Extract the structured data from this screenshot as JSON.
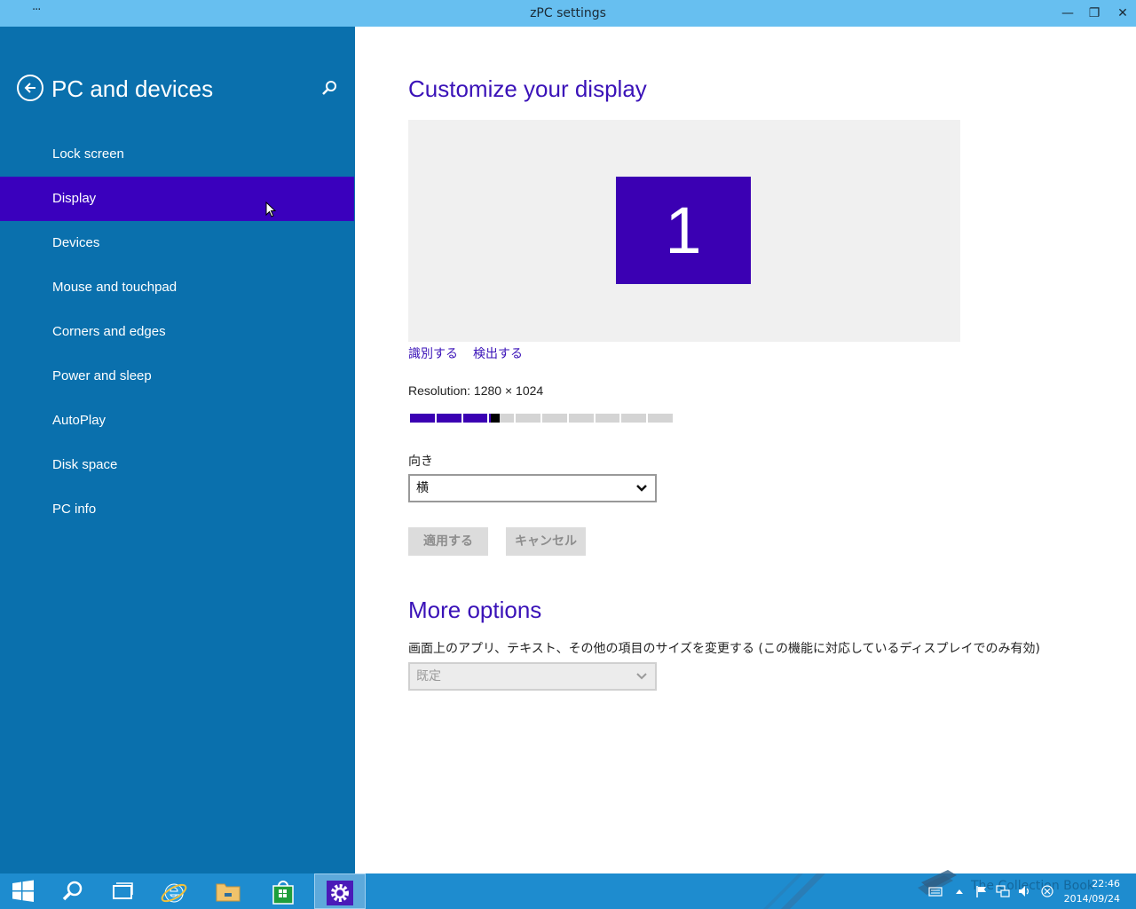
{
  "window": {
    "title": "zPC settings",
    "menu_glyph": "···",
    "minimize_glyph": "—",
    "restore_glyph": "❐",
    "close_glyph": "✕"
  },
  "sidebar": {
    "title": "PC and devices",
    "items": [
      {
        "label": "Lock screen",
        "selected": false
      },
      {
        "label": "Display",
        "selected": true
      },
      {
        "label": "Devices",
        "selected": false
      },
      {
        "label": "Mouse and touchpad",
        "selected": false
      },
      {
        "label": "Corners and edges",
        "selected": false
      },
      {
        "label": "Power and sleep",
        "selected": false
      },
      {
        "label": "AutoPlay",
        "selected": false
      },
      {
        "label": "Disk space",
        "selected": false
      },
      {
        "label": "PC info",
        "selected": false
      }
    ]
  },
  "main": {
    "title": "Customize your display",
    "monitor_number": "1",
    "identify_link": "識別する",
    "detect_link": "検出する",
    "resolution_label": "Resolution: 1280 × 1024",
    "resolution_level": 0.32,
    "orientation_label": "向き",
    "orientation_value": "横",
    "apply_button": "適用する",
    "cancel_button": "キャンセル",
    "more_title": "More options",
    "size_label": "画面上のアプリ、テキスト、その他の項目のサイズを変更する (この機能に対応しているディスプレイでのみ有効)",
    "size_value": "既定"
  },
  "taskbar": {
    "tray_text": "The Collection Book",
    "time": "22:46",
    "date": "2014/09/24"
  },
  "colors": {
    "accent": "#3a00bd",
    "sidebar": "#0a70ad",
    "titlebar": "#67bff0",
    "taskbar": "#1e8ccf"
  }
}
